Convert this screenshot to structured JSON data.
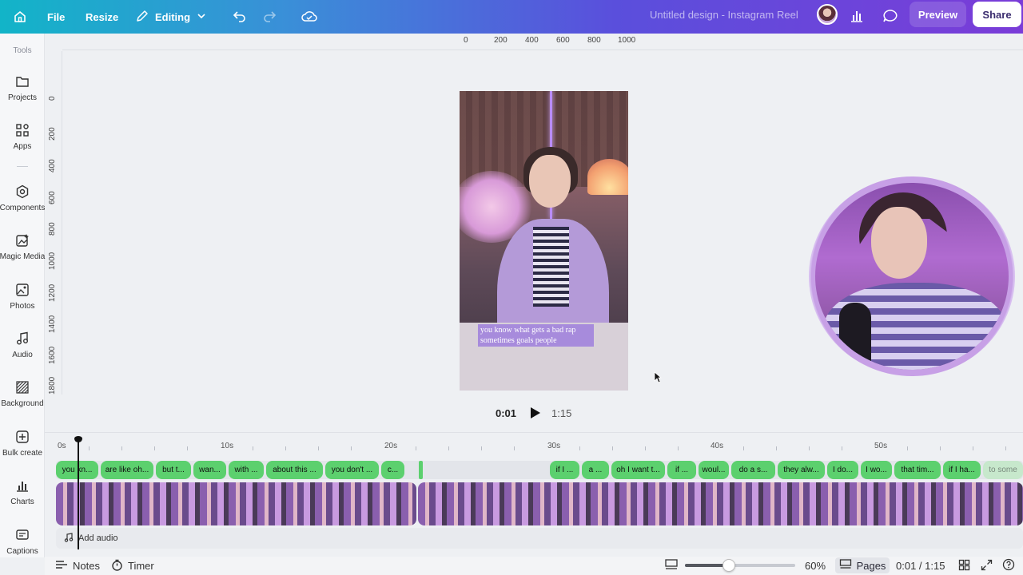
{
  "topbar": {
    "home_icon": "home-icon",
    "file_label": "File",
    "resize_label": "Resize",
    "editing_label": "Editing",
    "doc_title": "Untitled design - Instagram Reel",
    "preview_label": "Preview",
    "share_label": "Share"
  },
  "sidebar": {
    "heading": "Tools",
    "items": [
      {
        "label": "Projects",
        "icon": "folder-icon"
      },
      {
        "label": "Apps",
        "icon": "apps-icon"
      },
      {
        "label": "Components",
        "icon": "components-icon"
      },
      {
        "label": "Magic Media",
        "icon": "magic-media-icon"
      },
      {
        "label": "Photos",
        "icon": "photos-icon"
      },
      {
        "label": "Audio",
        "icon": "audio-icon"
      },
      {
        "label": "Background",
        "icon": "background-icon"
      },
      {
        "label": "Bulk create",
        "icon": "bulk-create-icon"
      },
      {
        "label": "Charts",
        "icon": "charts-icon"
      },
      {
        "label": "Captions",
        "icon": "captions-icon"
      }
    ]
  },
  "ruler": {
    "top": [
      "0",
      "200",
      "400",
      "600",
      "800",
      "1000"
    ],
    "left": [
      "0",
      "200",
      "400",
      "600",
      "800",
      "1000",
      "1200",
      "1400",
      "1600",
      "1800"
    ]
  },
  "canvas": {
    "caption_line1": "you know what gets a bad rap",
    "caption_line2": "sometimes goals people"
  },
  "player": {
    "current": "0:01",
    "total": "1:15"
  },
  "timeline": {
    "ticks": [
      "0s",
      "10s",
      "20s",
      "30s",
      "40s",
      "50s"
    ],
    "captions": [
      "you kn...",
      "are like oh...",
      "but t...",
      "wan...",
      "with ...",
      "about this ...",
      "you don't ...",
      "c...",
      "if I ...",
      "a ...",
      "oh I want t...",
      "if ...",
      "woul...",
      "do a s...",
      "they alw...",
      "I do...",
      "I wo...",
      "that tim...",
      "if I ha...",
      "to some"
    ],
    "add_audio_label": "Add audio"
  },
  "bottombar": {
    "notes_label": "Notes",
    "timer_label": "Timer",
    "zoom": "60%",
    "zoom_level": 0.4,
    "pages_label": "Pages",
    "time": "0:01 / 1:15"
  },
  "colors": {
    "caption_chip": "#5cd06e",
    "accent": "#7a3cd8"
  }
}
